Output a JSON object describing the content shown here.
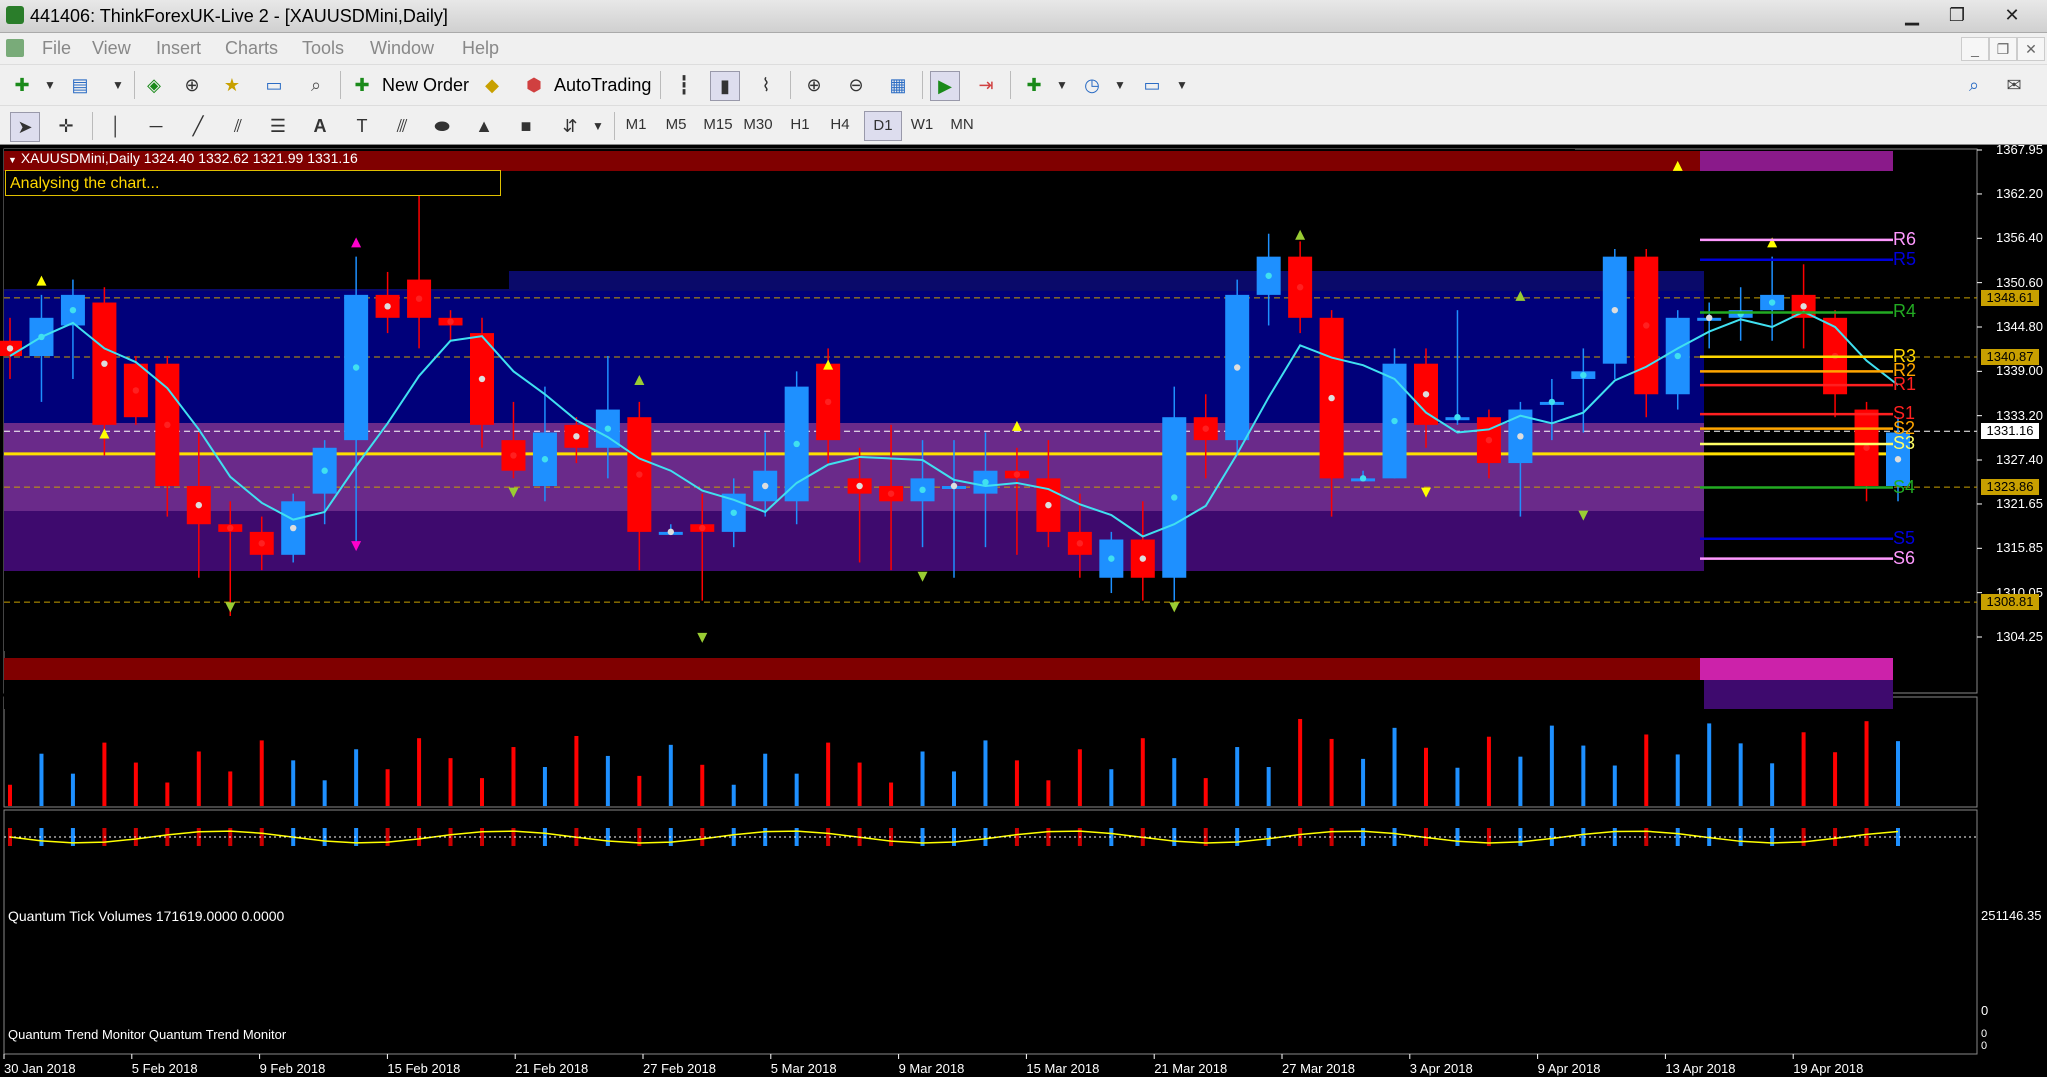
{
  "window": {
    "title": "441406: ThinkForexUK-Live 2 - [XAUUSDMini,Daily]"
  },
  "menu": [
    "File",
    "View",
    "Insert",
    "Charts",
    "Tools",
    "Window",
    "Help"
  ],
  "toolbar": {
    "new_order": "New Order",
    "autotrading": "AutoTrading"
  },
  "timeframes": [
    "M1",
    "M5",
    "M15",
    "M30",
    "H1",
    "H4",
    "D1",
    "W1",
    "MN"
  ],
  "active_timeframe": "D1",
  "chart": {
    "header": "XAUUSDMini,Daily  1324.40 1332.62 1321.99 1331.16",
    "status": "Analysing the chart...",
    "price_scale": [
      "1367.95",
      "1362.20",
      "1356.40",
      "1350.60",
      "1344.80",
      "1339.00",
      "1333.20",
      "1327.40",
      "1321.65",
      "1315.85",
      "1310.05",
      "1304.25"
    ],
    "price_tags": [
      {
        "label": "1348.61",
        "level": 1348.61,
        "bg": "#c8a000",
        "fg": "#000"
      },
      {
        "label": "1340.87",
        "level": 1340.87,
        "bg": "#c8a000",
        "fg": "#000"
      },
      {
        "label": "1331.16",
        "level": 1331.16,
        "bg": "#ffffff",
        "fg": "#000"
      },
      {
        "label": "1323.86",
        "level": 1323.86,
        "bg": "#c8a000",
        "fg": "#000"
      },
      {
        "label": "1308.81",
        "level": 1308.81,
        "bg": "#c8a000",
        "fg": "#000"
      }
    ],
    "pivots": [
      {
        "name": "R6",
        "level": 1356.2,
        "color": "#ff99ff"
      },
      {
        "name": "R5",
        "level": 1353.6,
        "color": "#0000dd"
      },
      {
        "name": "R4",
        "level": 1346.7,
        "color": "#22aa22"
      },
      {
        "name": "R3",
        "level": 1340.9,
        "color": "#ffd700"
      },
      {
        "name": "R2",
        "level": 1339.0,
        "color": "#ffa500"
      },
      {
        "name": "R1",
        "level": 1337.2,
        "color": "#ff2020"
      },
      {
        "name": "S1",
        "level": 1333.4,
        "color": "#ff2020"
      },
      {
        "name": "S2",
        "level": 1331.5,
        "color": "#ffa500"
      },
      {
        "name": "S3",
        "level": 1329.5,
        "color": "#ffff66"
      },
      {
        "name": "S4",
        "level": 1323.8,
        "color": "#22aa22"
      },
      {
        "name": "S5",
        "level": 1317.1,
        "color": "#0000dd"
      },
      {
        "name": "S6",
        "level": 1314.5,
        "color": "#ff99ff"
      }
    ],
    "dates": [
      "30 Jan 2018",
      "5 Feb 2018",
      "9 Feb 2018",
      "15 Feb 2018",
      "21 Feb 2018",
      "27 Feb 2018",
      "5 Mar 2018",
      "9 Mar 2018",
      "15 Mar 2018",
      "21 Mar 2018",
      "27 Mar 2018",
      "3 Apr 2018",
      "9 Apr 2018",
      "13 Apr 2018",
      "19 Apr 2018"
    ],
    "volume": {
      "header": "Quantum Tick Volumes 171619.0000 0.0000",
      "max": "251146.35",
      "zero": "0"
    },
    "trend": {
      "header": "Quantum Trend Monitor  Quantum Trend Monitor",
      "scale": [
        "0",
        "0"
      ]
    }
  },
  "colors": {
    "bull": "#1e90ff",
    "bear": "#ff0000",
    "ma": "#40e0f0"
  }
}
